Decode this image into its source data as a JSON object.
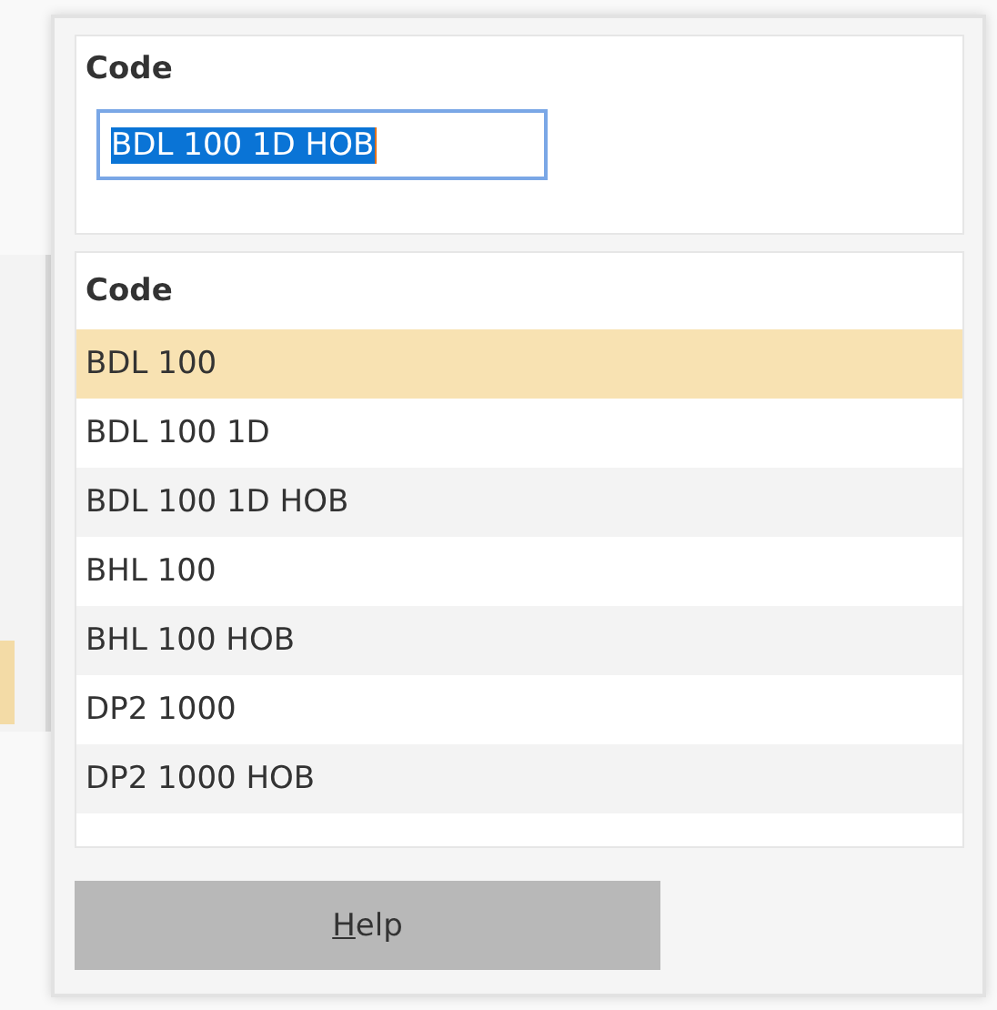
{
  "filter": {
    "label": "Code",
    "value": "BDL 100 1D HOB",
    "text_selected": true
  },
  "list": {
    "column": "Code",
    "rows": [
      {
        "code": "BDL 100",
        "selected": true
      },
      {
        "code": "BDL 100 1D",
        "selected": false
      },
      {
        "code": "BDL 100 1D HOB",
        "selected": false
      },
      {
        "code": "BHL 100",
        "selected": false
      },
      {
        "code": "BHL 100 HOB",
        "selected": false
      },
      {
        "code": "DP2 1000",
        "selected": false
      },
      {
        "code": "DP2 1000 HOB",
        "selected": false
      }
    ]
  },
  "buttons": [
    {
      "label": "Help",
      "mnemonic_underlined": true
    }
  ]
}
